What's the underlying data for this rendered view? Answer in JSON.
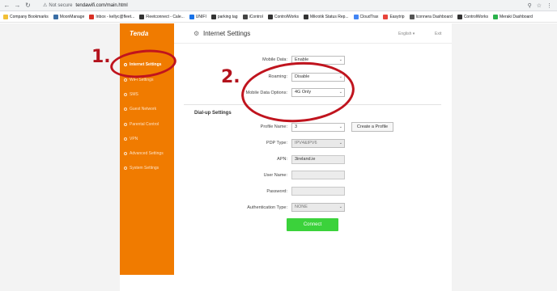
{
  "browser": {
    "security_label": "Not secure",
    "url": "tendawifi.com/main.html",
    "bookmarks": [
      "Company Bookmarks",
      "MoonManage",
      "Inbox - kellyc@fleet...",
      "Fleetconnect - Cale...",
      "UNIFI",
      "parking tag",
      "iControl",
      "ControlWorks",
      "Mikrotik Status Rep...",
      "CloudTrax",
      "Easytrip",
      "Iconnera Dashboard",
      "ControlWorks",
      "Meraki Dashboard"
    ]
  },
  "sidebar": {
    "logo": "Tenda",
    "items": [
      "Internet Settings",
      "WiFi Settings",
      "SMS",
      "Guest Network",
      "Parental Control",
      "VPN",
      "Advanced Settings",
      "System Settings"
    ]
  },
  "header": {
    "title": "Internet Settings",
    "language": "English",
    "exit": "Exit"
  },
  "form": {
    "mobile_data_label": "Mobile Data:",
    "mobile_data_value": "Enable",
    "roaming_label": "Roaming:",
    "roaming_value": "Disable",
    "options_label": "Mobile Data Options:",
    "options_value": "4G Only",
    "section_title": "Dial-up Settings",
    "profile_label": "Profile Name:",
    "profile_value": "3",
    "create_profile": "Create a Profile",
    "pdp_label": "PDP Type:",
    "pdp_value": "IPV4&IPV6",
    "apn_label": "APN:",
    "apn_value": "3ireland.ie",
    "user_label": "User Name:",
    "user_value": "",
    "password_label": "Password:",
    "password_value": "",
    "auth_label": "Authentication Type:",
    "auth_value": "NONE",
    "connect": "Connect"
  },
  "annotations": {
    "step1": "1.",
    "step2": "2."
  },
  "colors": {
    "sidebar": "#f07b00",
    "connect": "#3bd23b",
    "annotation": "#c0141e"
  }
}
